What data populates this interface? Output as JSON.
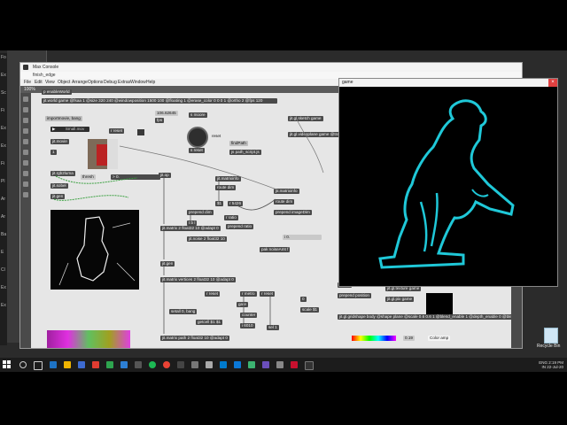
{
  "main_window": {
    "title": "Max Console",
    "subtitle_tab": "finish_edge",
    "menu": [
      "File",
      "Edit",
      "View",
      "Object",
      "Arrange",
      "Options",
      "Debug",
      "Extras",
      "Window",
      "Help"
    ],
    "toolbar_zoom": "100%"
  },
  "console": {
    "title": ""
  },
  "left_strip_labels": [
    "Fo",
    "Ex",
    "Sc",
    "Fi",
    "Ex",
    "Ex",
    "Fi",
    "Pl",
    "Ar",
    "Ar",
    "Ba",
    "E",
    "Cl",
    "Ex",
    "Ex"
  ],
  "game_window": {
    "title": "game"
  },
  "patch": {
    "enableWorld": "p enableWorld",
    "world": "jit.world game @fsaa 1 @size 320 240 @windowposition 1500 100 @floating 1 @erase_color 0 0 0 1 @ortho 2 @fps 120",
    "importmovie": "importmovie, bang",
    "jit_movie": "jit.movie",
    "smallvideo": "Small.mov",
    "r_reset": "r reset",
    "jit_rgb2luma": "jit.rgb2luma",
    "thresh": "thresh",
    "gt_thresh": "> 0.",
    "jit_sobel": "jit.sobel",
    "jit_gen": "jit.gen",
    "jit_op": "jit.op",
    "value1": "106.62645",
    "fps": "fps",
    "s_moore": "s moore",
    "reset": "reset",
    "s_reset": "s reset",
    "findpath": "findPath",
    "js_path": "js path_script.js",
    "jit_matrixinfo": "jit.matrixinfo",
    "route_dim": "route dim",
    "prepend_imagedim": "prepend imageDim",
    "gl_sketch": "jit.gl.sketch game",
    "gl_videoplane": "jit.gl.videoplane game @transform_reset 2",
    "gl_gridshape": "jit.gl.gridshape body @shape plane @scale 0.6 0.6 1 @blend_enable 1 @depth_enable 0 @blend add",
    "jit_matrix2": "jit.matrix 2 float32 10 @adapt 0",
    "jit_noise": "jit.noise 2 float32 10",
    "jit_matrix_vertices": "jit.matrix vertices 2 float32 10 @adapt 0",
    "jit_matrix_path": "jit.matrix path 2 float32 10 @adapt 0",
    "jit_gen2": "jit.gen",
    "t_b_l": "t b l",
    "prepend_dim": "prepend dim",
    "rectangle": "$1",
    "r_5426": "r 5426",
    "r_ratio": "r ratio",
    "prepend_ratio": "prepend ratio",
    "pak_noiseamt": "pak noiseAmt f",
    "i_0": "i 0.",
    "r_reset2": "r reset",
    "r_metro": "r metro",
    "r_reset3": "r reset",
    "gate": "gate",
    "counter": "counter",
    "i_6010": "i 6010",
    "getcell": "getcell $1 $1",
    "setall": "setall 0, bang",
    "sel1": "sel 1",
    "prepend_position": "prepend position",
    "scale": "scale $1",
    "jit_gl_texture": "jit.gl.texture game",
    "jit_gl_pix": "jit.gl.pix game",
    "val_019": "0.19",
    "color_amp": "Color amp",
    "val_1": "1",
    "val_0": "0",
    "val_35": "$4 $5"
  },
  "taskbar": {
    "time": "2:19 PM",
    "date": "22-Jul-20",
    "lang": "ENG",
    "region": "IN",
    "recycle_bin": "Recycle Bin"
  },
  "colors": {
    "background": "#2b2b2b",
    "patch_bg": "#e6e6e6",
    "object_box": "#4a4a4a",
    "game_outline": "#1fc8d8",
    "spectrum_magenta": "#d020d0",
    "taskbar": "#1c1c1c"
  }
}
